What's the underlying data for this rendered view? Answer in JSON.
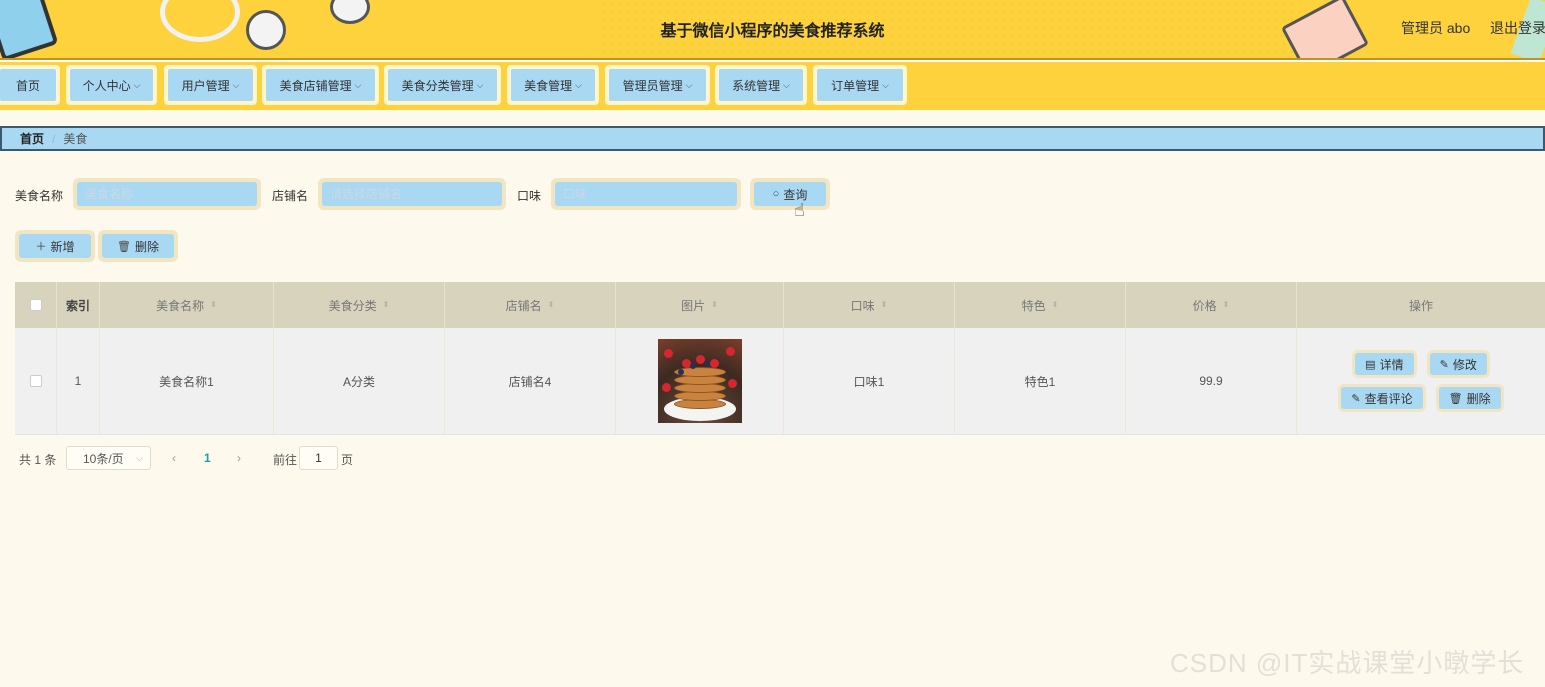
{
  "header": {
    "title": "基于微信小程序的美食推荐系统",
    "admin": "管理员 abo",
    "logout": "退出登录"
  },
  "nav": [
    {
      "label": "首页",
      "dropdown": false
    },
    {
      "label": "个人中心",
      "dropdown": true
    },
    {
      "label": "用户管理",
      "dropdown": true
    },
    {
      "label": "美食店铺管理",
      "dropdown": true
    },
    {
      "label": "美食分类管理",
      "dropdown": true
    },
    {
      "label": "美食管理",
      "dropdown": true
    },
    {
      "label": "管理员管理",
      "dropdown": true
    },
    {
      "label": "系统管理",
      "dropdown": true
    },
    {
      "label": "订单管理",
      "dropdown": true
    }
  ],
  "breadcrumb": {
    "home": "首页",
    "separator": "/",
    "current": "美食"
  },
  "search": {
    "name_label": "美食名称",
    "name_placeholder": "美食名称",
    "shop_label": "店铺名",
    "shop_placeholder": "请选择店铺名",
    "taste_label": "口味",
    "taste_placeholder": "口味",
    "query_button": "查询"
  },
  "actions": {
    "add": "新增",
    "delete": "删除"
  },
  "table": {
    "columns": [
      "索引",
      "美食名称",
      "美食分类",
      "店铺名",
      "图片",
      "口味",
      "特色",
      "价格",
      "操作"
    ],
    "rows": [
      {
        "index": "1",
        "name": "美食名称1",
        "category": "A分类",
        "shop": "店铺名4",
        "taste": "口味1",
        "feature": "特色1",
        "price": "99.9"
      }
    ],
    "row_actions": {
      "detail": "详情",
      "edit": "修改",
      "comments": "查看评论",
      "delete": "删除"
    }
  },
  "pagination": {
    "total": "共 1 条",
    "page_size": "10条/页",
    "current_page": "1",
    "goto_label": "前往",
    "goto_value": "1",
    "page_suffix": "页"
  },
  "watermark": "CSDN @IT实战课堂小暾学长",
  "colors": {
    "header": "#fdd23d",
    "button": "#a9d8f3",
    "accent": "#1aa0a7",
    "background": "#fdf9ec"
  }
}
